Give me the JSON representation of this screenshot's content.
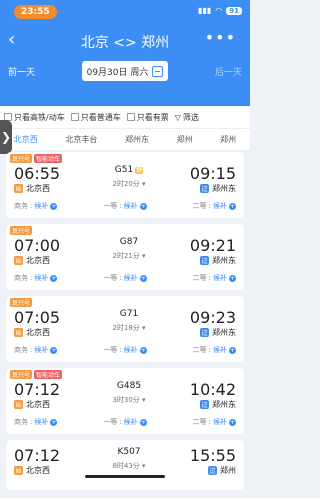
{
  "status": {
    "time": "23:55",
    "battery": "91"
  },
  "header": {
    "title": "北京 <> 郑州",
    "prev_day": "前一天",
    "next_day": "后一天",
    "date": "09月30日 周六"
  },
  "filters": [
    {
      "label": "只看高铁/动车"
    },
    {
      "label": "只看普通车"
    },
    {
      "label": "只看有票"
    },
    {
      "label": "筛选"
    }
  ],
  "stations": [
    "北京西",
    "北京丰台",
    "郑州东",
    "郑州",
    "郑州"
  ],
  "trains": [
    {
      "badges": [
        "复兴号",
        "智能动车"
      ],
      "dep": "06:55",
      "train": "G51",
      "jing": "静",
      "dur": "2时20分",
      "arr": "09:15",
      "from": "北京西",
      "to": "郑州东",
      "from_icon": "始",
      "to_icon": "过",
      "seats": [
        {
          "cls": "商务",
          "status": "候补"
        },
        {
          "cls": "一等",
          "status": "候补"
        },
        {
          "cls": "二等",
          "status": "候补"
        }
      ]
    },
    {
      "badges": [
        "复兴号"
      ],
      "dep": "07:00",
      "train": "G87",
      "jing": "",
      "dur": "2时21分",
      "arr": "09:21",
      "from": "北京西",
      "to": "郑州东",
      "from_icon": "始",
      "to_icon": "过",
      "seats": [
        {
          "cls": "商务",
          "status": "候补"
        },
        {
          "cls": "一等",
          "status": "候补"
        },
        {
          "cls": "二等",
          "status": "候补"
        }
      ]
    },
    {
      "badges": [
        "复兴号"
      ],
      "dep": "07:05",
      "train": "G71",
      "jing": "",
      "dur": "2时18分",
      "arr": "09:23",
      "from": "北京西",
      "to": "郑州东",
      "from_icon": "始",
      "to_icon": "过",
      "seats": [
        {
          "cls": "商务",
          "status": "候补"
        },
        {
          "cls": "一等",
          "status": "候补"
        },
        {
          "cls": "二等",
          "status": "候补"
        }
      ]
    },
    {
      "badges": [
        "复兴号",
        "智能动车"
      ],
      "dep": "07:12",
      "train": "G485",
      "jing": "",
      "dur": "3时30分",
      "arr": "10:42",
      "from": "北京西",
      "to": "郑州东",
      "from_icon": "始",
      "to_icon": "过",
      "seats": [
        {
          "cls": "商务",
          "status": "候补"
        },
        {
          "cls": "一等",
          "status": "候补"
        },
        {
          "cls": "二等",
          "status": "候补"
        }
      ]
    },
    {
      "badges": [],
      "dep": "07:12",
      "train": "K507",
      "jing": "",
      "dur": "8时43分",
      "arr": "15:55",
      "from": "北京西",
      "to": "郑州",
      "from_icon": "始",
      "to_icon": "过",
      "seats": []
    }
  ]
}
